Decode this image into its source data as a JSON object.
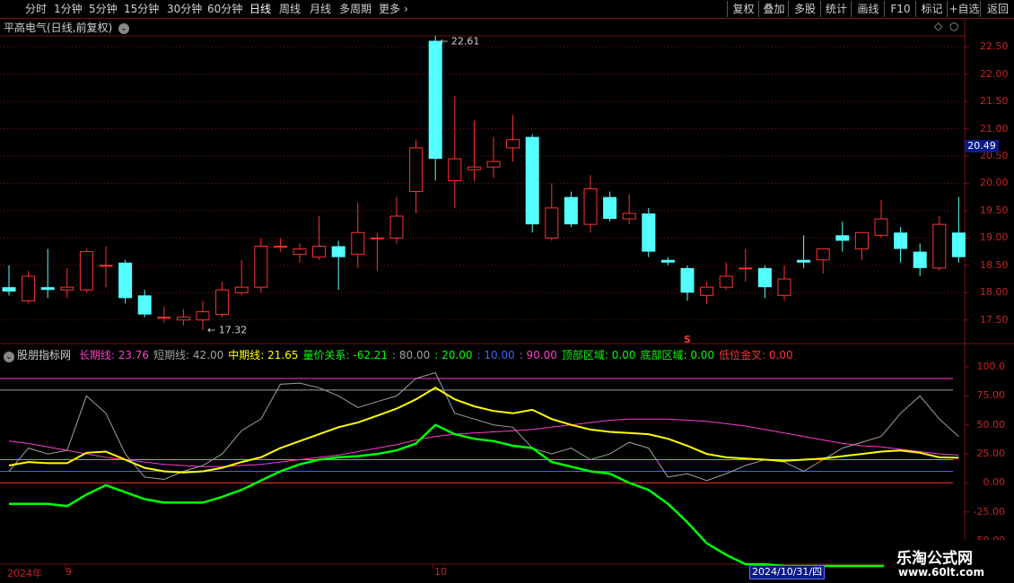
{
  "toolbar": {
    "tabs": [
      "分时",
      "1分钟",
      "5分钟",
      "15分钟",
      "30分钟",
      "60分钟",
      "日线",
      "周线",
      "月线",
      "多周期",
      "更多"
    ],
    "active_tab": "日线",
    "right_buttons": [
      "复权",
      "叠加",
      "多股",
      "统计",
      "画线",
      "F10",
      "标记",
      "+自选",
      "返回"
    ]
  },
  "main_chart": {
    "title": "平高电气(日线,前复权)",
    "price_ticks": [
      "22.50",
      "22.00",
      "21.50",
      "21.00",
      "20.50",
      "20.00",
      "19.50",
      "19.00",
      "18.50",
      "18.00",
      "17.50"
    ],
    "current_price": "20.49",
    "high_label": "22.61",
    "low_label": "17.32",
    "signal_marker": "S"
  },
  "indicator": {
    "name": "股朋指标网",
    "items": [
      {
        "label": "长期线:",
        "value": "23.76",
        "color": "#ff3cc8"
      },
      {
        "label": "短期线:",
        "value": "42.00",
        "color": "#a0a0a0"
      },
      {
        "label": "中期线:",
        "value": "21.65",
        "color": "#ffff00"
      },
      {
        "label": "量价关系:",
        "value": "-62.21",
        "color": "#00ff00"
      },
      {
        "label": ":",
        "value": "80.00",
        "color": "#a0a0a0"
      },
      {
        "label": ":",
        "value": "20.00",
        "color": "#00ff00"
      },
      {
        "label": ":",
        "value": "10.00",
        "color": "#3c64ff"
      },
      {
        "label": ":",
        "value": "90.00",
        "color": "#ff3cc8"
      },
      {
        "label": "顶部区域:",
        "value": "0.00",
        "color": "#00ff00"
      },
      {
        "label": "底部区域:",
        "value": "0.00",
        "color": "#00ff00"
      },
      {
        "label": "低位金叉:",
        "value": "0.00",
        "color": "#ff3333"
      }
    ],
    "ticks": [
      "100.0",
      "75.00",
      "50.00",
      "25.00",
      "0.00",
      "-25.00",
      "-50.00"
    ]
  },
  "x_axis": {
    "labels": [
      "2024年",
      "9",
      "10"
    ],
    "cursor_date": "2024/10/31/四"
  },
  "watermark": {
    "line1": "乐淘公式网",
    "line2": "www.60lt.com"
  },
  "colors": {
    "up": "#ff3232",
    "down": "#54ffff",
    "grid": "#7a1010"
  },
  "chart_data": [
    {
      "type": "candlestick",
      "title": "平高电气(日线,前复权)",
      "ylim": [
        17.2,
        22.7
      ],
      "candles": [
        {
          "o": 18.1,
          "h": 18.5,
          "l": 17.95,
          "c": 18.02
        },
        {
          "o": 17.85,
          "h": 18.4,
          "l": 17.8,
          "c": 18.3
        },
        {
          "o": 18.1,
          "h": 18.8,
          "l": 17.9,
          "c": 18.05
        },
        {
          "o": 18.05,
          "h": 18.45,
          "l": 17.9,
          "c": 18.1
        },
        {
          "o": 18.05,
          "h": 18.8,
          "l": 18.0,
          "c": 18.75
        },
        {
          "o": 18.5,
          "h": 18.85,
          "l": 18.1,
          "c": 18.5
        },
        {
          "o": 18.55,
          "h": 18.6,
          "l": 17.8,
          "c": 17.9
        },
        {
          "o": 17.95,
          "h": 18.05,
          "l": 17.55,
          "c": 17.6
        },
        {
          "o": 17.55,
          "h": 17.75,
          "l": 17.45,
          "c": 17.55
        },
        {
          "o": 17.5,
          "h": 17.7,
          "l": 17.4,
          "c": 17.55
        },
        {
          "o": 17.5,
          "h": 17.85,
          "l": 17.32,
          "c": 17.65
        },
        {
          "o": 17.6,
          "h": 18.2,
          "l": 17.55,
          "c": 18.05
        },
        {
          "o": 18.0,
          "h": 18.6,
          "l": 17.95,
          "c": 18.1
        },
        {
          "o": 18.1,
          "h": 19.0,
          "l": 18.0,
          "c": 18.85
        },
        {
          "o": 18.85,
          "h": 19.0,
          "l": 18.75,
          "c": 18.85
        },
        {
          "o": 18.7,
          "h": 18.9,
          "l": 18.55,
          "c": 18.8
        },
        {
          "o": 18.65,
          "h": 19.4,
          "l": 18.6,
          "c": 18.85
        },
        {
          "o": 18.85,
          "h": 18.95,
          "l": 18.05,
          "c": 18.65
        },
        {
          "o": 18.7,
          "h": 19.65,
          "l": 18.45,
          "c": 19.1
        },
        {
          "o": 19.0,
          "h": 19.1,
          "l": 18.4,
          "c": 19.0
        },
        {
          "o": 19.0,
          "h": 19.75,
          "l": 18.9,
          "c": 19.4
        },
        {
          "o": 19.85,
          "h": 20.8,
          "l": 19.45,
          "c": 20.65
        },
        {
          "o": 22.61,
          "h": 22.7,
          "l": 20.05,
          "c": 20.45
        },
        {
          "o": 20.05,
          "h": 21.6,
          "l": 19.55,
          "c": 20.45
        },
        {
          "o": 20.25,
          "h": 21.15,
          "l": 20.05,
          "c": 20.3
        },
        {
          "o": 20.3,
          "h": 20.85,
          "l": 20.1,
          "c": 20.4
        },
        {
          "o": 20.65,
          "h": 21.25,
          "l": 20.4,
          "c": 20.8
        },
        {
          "o": 20.85,
          "h": 20.9,
          "l": 19.1,
          "c": 19.25
        },
        {
          "o": 19.0,
          "h": 20.0,
          "l": 18.95,
          "c": 19.55
        },
        {
          "o": 19.75,
          "h": 19.85,
          "l": 19.2,
          "c": 19.25
        },
        {
          "o": 19.25,
          "h": 20.15,
          "l": 19.1,
          "c": 19.9
        },
        {
          "o": 19.75,
          "h": 19.85,
          "l": 19.3,
          "c": 19.35
        },
        {
          "o": 19.35,
          "h": 19.8,
          "l": 19.25,
          "c": 19.45
        },
        {
          "o": 19.45,
          "h": 19.55,
          "l": 18.65,
          "c": 18.75
        },
        {
          "o": 18.6,
          "h": 18.65,
          "l": 18.5,
          "c": 18.55
        },
        {
          "o": 18.45,
          "h": 18.5,
          "l": 17.85,
          "c": 18.0
        },
        {
          "o": 17.95,
          "h": 18.2,
          "l": 17.8,
          "c": 18.1
        },
        {
          "o": 18.1,
          "h": 18.55,
          "l": 18.05,
          "c": 18.3
        },
        {
          "o": 18.45,
          "h": 18.8,
          "l": 18.2,
          "c": 18.45
        },
        {
          "o": 18.45,
          "h": 18.5,
          "l": 17.9,
          "c": 18.1
        },
        {
          "o": 17.95,
          "h": 18.5,
          "l": 17.85,
          "c": 18.25
        },
        {
          "o": 18.6,
          "h": 19.05,
          "l": 18.45,
          "c": 18.55
        },
        {
          "o": 18.6,
          "h": 18.8,
          "l": 18.35,
          "c": 18.8
        },
        {
          "o": 19.05,
          "h": 19.3,
          "l": 18.75,
          "c": 18.95
        },
        {
          "o": 18.8,
          "h": 19.1,
          "l": 18.6,
          "c": 19.1
        },
        {
          "o": 19.05,
          "h": 19.7,
          "l": 19.0,
          "c": 19.35
        },
        {
          "o": 19.1,
          "h": 19.2,
          "l": 18.55,
          "c": 18.8
        },
        {
          "o": 18.75,
          "h": 18.9,
          "l": 18.3,
          "c": 18.45
        },
        {
          "o": 18.45,
          "h": 19.4,
          "l": 18.4,
          "c": 19.25
        },
        {
          "o": 19.1,
          "h": 19.75,
          "l": 18.55,
          "c": 18.65
        }
      ]
    },
    {
      "type": "line",
      "title": "股朋指标网",
      "ylim": [
        -70,
        100
      ],
      "reference_lines": [
        90,
        80,
        20,
        10,
        0
      ],
      "series": [
        {
          "name": "长期线",
          "color": "#ff3cc8",
          "values": [
            36,
            34,
            31,
            28,
            25,
            22,
            20,
            18,
            16,
            15,
            14,
            14,
            15,
            16,
            18,
            20,
            22,
            24,
            27,
            30,
            33,
            37,
            40,
            42,
            43,
            44,
            45,
            46,
            48,
            50,
            52,
            54,
            55,
            55,
            55,
            54,
            53,
            51,
            49,
            46,
            43,
            40,
            37,
            34,
            32,
            31,
            29,
            27,
            25,
            24
          ]
        },
        {
          "name": "短期线",
          "color": "#a0a0a0",
          "values": [
            10,
            30,
            25,
            28,
            75,
            60,
            25,
            5,
            3,
            10,
            15,
            25,
            45,
            55,
            85,
            86,
            82,
            75,
            65,
            70,
            75,
            90,
            95,
            60,
            55,
            50,
            48,
            30,
            25,
            30,
            20,
            25,
            35,
            30,
            5,
            8,
            2,
            8,
            15,
            20,
            18,
            10,
            20,
            30,
            35,
            40,
            60,
            75,
            55,
            40
          ]
        },
        {
          "name": "中期线",
          "color": "#ffff00",
          "values": [
            15,
            18,
            17,
            17,
            26,
            27,
            20,
            13,
            10,
            9,
            10,
            13,
            18,
            22,
            30,
            36,
            42,
            48,
            52,
            58,
            64,
            72,
            82,
            72,
            66,
            62,
            60,
            63,
            55,
            50,
            46,
            44,
            43,
            42,
            38,
            32,
            25,
            22,
            21,
            20,
            19,
            20,
            21,
            23,
            25,
            27,
            28,
            26,
            22,
            21.65
          ]
        },
        {
          "name": "量价关系",
          "color": "#00ff00",
          "values": [
            -18,
            -18,
            -18,
            -20,
            -10,
            -2,
            -8,
            -14,
            -17,
            -17,
            -17,
            -12,
            -6,
            2,
            10,
            16,
            20,
            22,
            23,
            25,
            28,
            34,
            50,
            42,
            38,
            36,
            32,
            30,
            18,
            14,
            10,
            8,
            0,
            -6,
            -18,
            -34,
            -52,
            -62,
            -70,
            -70,
            -80,
            -83,
            -88,
            -98,
            -92,
            -86,
            -80,
            -77,
            -71,
            -62.21
          ]
        }
      ]
    }
  ]
}
